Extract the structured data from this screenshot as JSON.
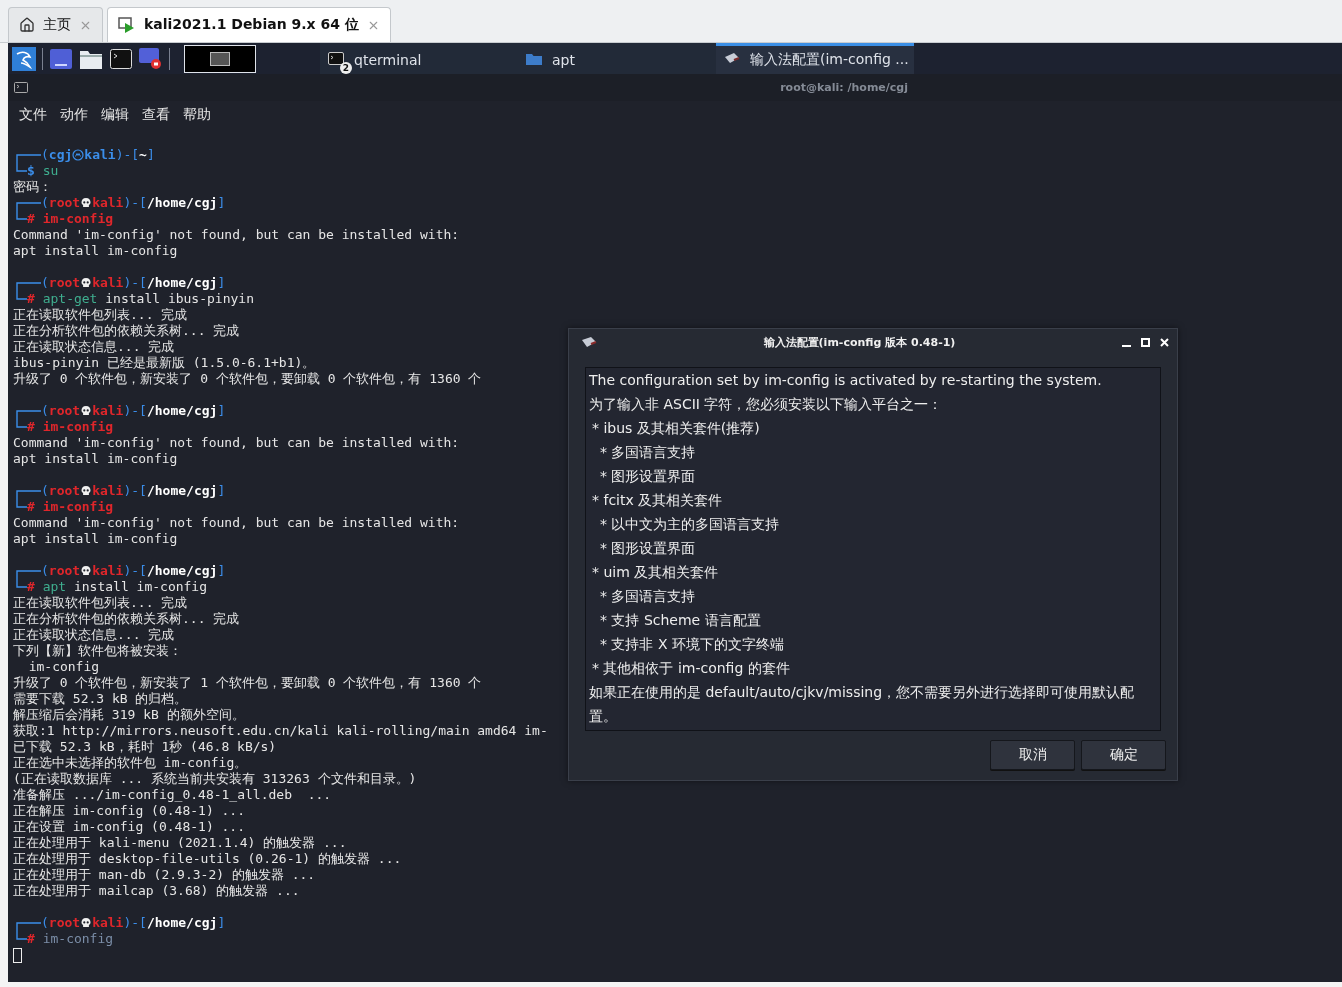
{
  "browser_tabs": [
    {
      "label": "主页",
      "kind": "home",
      "selected": false
    },
    {
      "label": "kali2021.1 Debian 9.x 64 位",
      "kind": "vm",
      "selected": true
    }
  ],
  "panel": {
    "tasks": [
      {
        "label": "qterminal",
        "kind": "terminal",
        "badge": "2",
        "selected": false
      },
      {
        "label": "apt",
        "kind": "folder",
        "selected": false
      },
      {
        "label": "输入法配置(im-config ...",
        "kind": "app",
        "selected": true
      }
    ]
  },
  "terminal": {
    "title": "root@kali: /home/cgj",
    "menu": [
      "文件",
      "动作",
      "编辑",
      "查看",
      "帮助"
    ],
    "lines": [
      {
        "kind": "head",
        "open": "(",
        "user": "cgj",
        "host": "kali",
        "mid": ")-[",
        "path": "~",
        "close": "]",
        "privileged": false
      },
      {
        "kind": "cmd",
        "symbol": "$",
        "privileged": false,
        "parts": [
          {
            "text": "su",
            "kind": "found"
          }
        ]
      },
      {
        "kind": "out",
        "text": "密码："
      },
      {
        "kind": "head",
        "open": "(",
        "user": "root",
        "host": "kali",
        "mid": ")-[",
        "path": "/home/cgj",
        "close": "]",
        "privileged": true
      },
      {
        "kind": "cmd",
        "symbol": "#",
        "privileged": true,
        "parts": [
          {
            "text": "im-config",
            "kind": "missing"
          }
        ]
      },
      {
        "kind": "out",
        "text": "Command 'im-config' not found, but can be installed with:"
      },
      {
        "kind": "out",
        "text": "apt install im-config"
      },
      {
        "kind": "blank"
      },
      {
        "kind": "head",
        "open": "(",
        "user": "root",
        "host": "kali",
        "mid": ")-[",
        "path": "/home/cgj",
        "close": "]",
        "privileged": true
      },
      {
        "kind": "cmd",
        "symbol": "#",
        "privileged": true,
        "parts": [
          {
            "text": "apt-get",
            "kind": "found"
          },
          {
            "text": " install ibus-pinyin",
            "kind": "arg"
          }
        ]
      },
      {
        "kind": "out",
        "text": "正在读取软件包列表... 完成"
      },
      {
        "kind": "out",
        "text": "正在分析软件包的依赖关系树... 完成"
      },
      {
        "kind": "out",
        "text": "正在读取状态信息... 完成"
      },
      {
        "kind": "out",
        "text": "ibus-pinyin 已经是最新版 (1.5.0-6.1+b1)。"
      },
      {
        "kind": "out",
        "text": "升级了 0 个软件包，新安装了 0 个软件包，要卸载 0 个软件包，有 1360 个"
      },
      {
        "kind": "blank"
      },
      {
        "kind": "head",
        "open": "(",
        "user": "root",
        "host": "kali",
        "mid": ")-[",
        "path": "/home/cgj",
        "close": "]",
        "privileged": true
      },
      {
        "kind": "cmd",
        "symbol": "#",
        "privileged": true,
        "parts": [
          {
            "text": "im-config",
            "kind": "missing"
          }
        ]
      },
      {
        "kind": "out",
        "text": "Command 'im-config' not found, but can be installed with:"
      },
      {
        "kind": "out",
        "text": "apt install im-config"
      },
      {
        "kind": "blank"
      },
      {
        "kind": "head",
        "open": "(",
        "user": "root",
        "host": "kali",
        "mid": ")-[",
        "path": "/home/cgj",
        "close": "]",
        "privileged": true
      },
      {
        "kind": "cmd",
        "symbol": "#",
        "privileged": true,
        "parts": [
          {
            "text": "im-config",
            "kind": "missing"
          }
        ]
      },
      {
        "kind": "out",
        "text": "Command 'im-config' not found, but can be installed with:"
      },
      {
        "kind": "out",
        "text": "apt install im-config"
      },
      {
        "kind": "blank"
      },
      {
        "kind": "head",
        "open": "(",
        "user": "root",
        "host": "kali",
        "mid": ")-[",
        "path": "/home/cgj",
        "close": "]",
        "privileged": true
      },
      {
        "kind": "cmd",
        "symbol": "#",
        "privileged": true,
        "parts": [
          {
            "text": "apt",
            "kind": "found"
          },
          {
            "text": " install im-config",
            "kind": "arg"
          }
        ]
      },
      {
        "kind": "out",
        "text": "正在读取软件包列表... 完成"
      },
      {
        "kind": "out",
        "text": "正在分析软件包的依赖关系树... 完成"
      },
      {
        "kind": "out",
        "text": "正在读取状态信息... 完成"
      },
      {
        "kind": "out",
        "text": "下列【新】软件包将被安装："
      },
      {
        "kind": "out",
        "text": "  im-config"
      },
      {
        "kind": "out",
        "text": "升级了 0 个软件包，新安装了 1 个软件包，要卸载 0 个软件包，有 1360 个"
      },
      {
        "kind": "out",
        "text": "需要下载 52.3 kB 的归档。"
      },
      {
        "kind": "out",
        "text": "解压缩后会消耗 319 kB 的额外空间。"
      },
      {
        "kind": "out",
        "text": "获取:1 http://mirrors.neusoft.edu.cn/kali kali-rolling/main amd64 im-"
      },
      {
        "kind": "out",
        "text": "已下载 52.3 kB，耗时 1秒 (46.8 kB/s)"
      },
      {
        "kind": "out",
        "text": "正在选中未选择的软件包 im-config。"
      },
      {
        "kind": "out",
        "text": "(正在读取数据库 ... 系统当前共安装有 313263 个文件和目录。)"
      },
      {
        "kind": "out",
        "text": "准备解压 .../im-config_0.48-1_all.deb  ..."
      },
      {
        "kind": "out",
        "text": "正在解压 im-config (0.48-1) ..."
      },
      {
        "kind": "out",
        "text": "正在设置 im-config (0.48-1) ..."
      },
      {
        "kind": "out",
        "text": "正在处理用于 kali-menu (2021.1.4) 的触发器 ..."
      },
      {
        "kind": "out",
        "text": "正在处理用于 desktop-file-utils (0.26-1) 的触发器 ..."
      },
      {
        "kind": "out",
        "text": "正在处理用于 man-db (2.9.3-2) 的触发器 ..."
      },
      {
        "kind": "out",
        "text": "正在处理用于 mailcap (3.68) 的触发器 ..."
      },
      {
        "kind": "blank"
      },
      {
        "kind": "head",
        "open": "(",
        "user": "root",
        "host": "kali",
        "mid": ")-[",
        "path": "/home/cgj",
        "close": "]",
        "privileged": true
      },
      {
        "kind": "cmd",
        "symbol": "#",
        "privileged": true,
        "parts": [
          {
            "text": "im-config",
            "kind": "pending"
          }
        ]
      },
      {
        "kind": "cursor"
      }
    ]
  },
  "dialog": {
    "title": "输入法配置(im-config 版本 0.48-1)",
    "lines": [
      {
        "kind": "para",
        "text": "The configuration set by im-config is activated by re-starting the system."
      },
      {
        "kind": "para",
        "text": "为了输入非 ASCII 字符，您必须安装以下输入平台之一："
      },
      {
        "kind": "item",
        "text": "* ibus 及其相关套件(推荐)",
        "children": [
          {
            "kind": "item",
            "text": "* 多国语言支持"
          },
          {
            "kind": "item",
            "text": "* 图形设置界面"
          }
        ]
      },
      {
        "kind": "item",
        "text": "* fcitx 及其相关套件",
        "children": [
          {
            "kind": "item",
            "text": "* 以中文为主的多国语言支持"
          },
          {
            "kind": "item",
            "text": "* 图形设置界面"
          }
        ]
      },
      {
        "kind": "item",
        "text": "* uim 及其相关套件",
        "children": [
          {
            "kind": "item",
            "text": "* 多国语言支持"
          },
          {
            "kind": "item",
            "text": "* 支持 Scheme 语言配置"
          },
          {
            "kind": "item",
            "text": "* 支持非 X 环境下的文字终端"
          }
        ]
      },
      {
        "kind": "item",
        "text": "* 其他相依于 im-config 的套件"
      },
      {
        "kind": "para",
        "text": "如果正在使用的是 default/auto/cjkv/missing，您不需要另外进行选择即可使用默认配置。"
      }
    ],
    "buttons": [
      "取消",
      "确定"
    ]
  }
}
